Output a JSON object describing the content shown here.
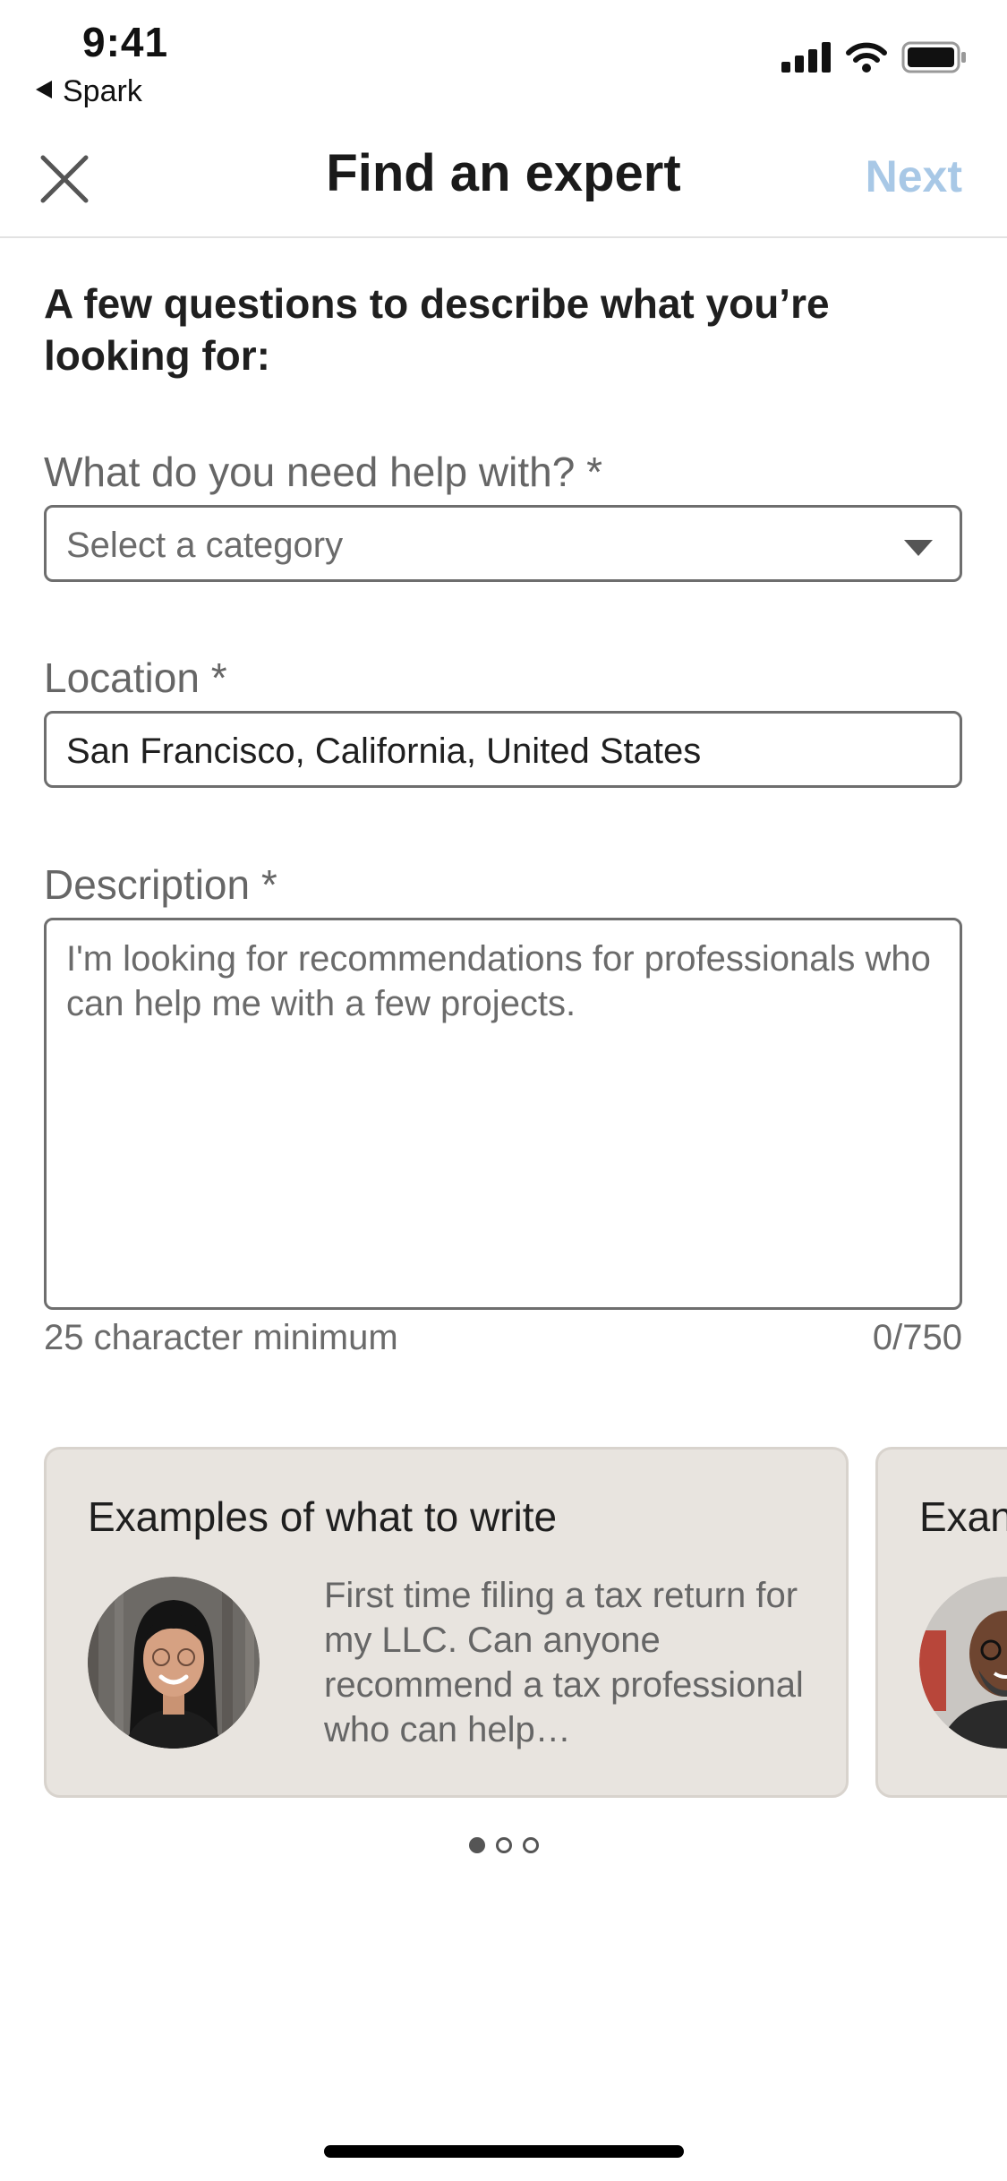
{
  "status_bar": {
    "time": "9:41",
    "back_app_label": "Spark",
    "icons": [
      "signal-icon",
      "wifi-icon",
      "battery-icon"
    ]
  },
  "nav": {
    "close_icon": "close-icon",
    "title": "Find an expert",
    "next_label": "Next",
    "next_color": "#a8c8e6"
  },
  "form": {
    "intro": "A few questions to describe what you’re looking for:",
    "category": {
      "label": "What do you need help with? *",
      "placeholder": "Select a category"
    },
    "location": {
      "label": "Location *",
      "value": "San Francisco, California, United States"
    },
    "description": {
      "label": "Description *",
      "placeholder": "I'm looking for recommendations for professionals who can help me with a few projects.",
      "helper": "25 character minimum",
      "counter": "0/750"
    }
  },
  "examples": {
    "cards": [
      {
        "title": "Examples of what to write",
        "body": "First time filing a tax return for my LLC. Can anyone recommend a tax professional who can help…"
      },
      {
        "title": "Exan"
      }
    ],
    "page_count": 3,
    "active_page": 1
  },
  "colors": {
    "card_background": "#e8e4df",
    "accent_disabled": "#a8c8e6"
  }
}
